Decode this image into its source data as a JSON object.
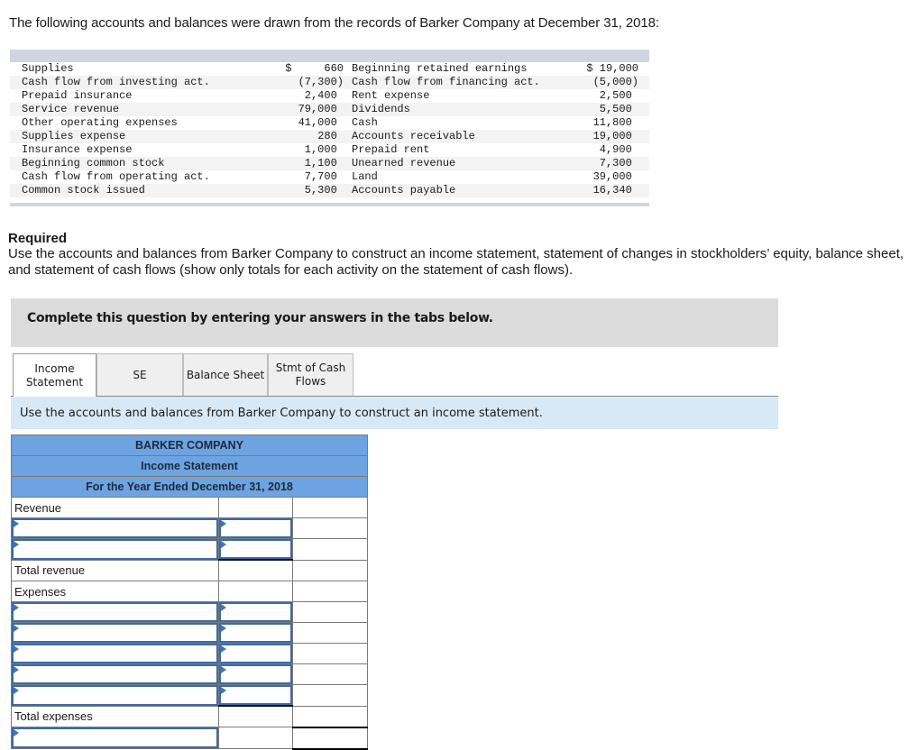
{
  "intro": "The following accounts and balances were drawn from the records of Barker Company at December 31, 2018:",
  "accounts": {
    "rows": [
      {
        "left_name": "Supplies",
        "left_value": "$     660",
        "right_name": "Beginning retained earnings",
        "right_value": "$ 19,000"
      },
      {
        "left_name": "Cash flow from investing act.",
        "left_value": "(7,300)",
        "right_name": "Cash flow from financing act.",
        "right_value": "(5,000)"
      },
      {
        "left_name": "Prepaid insurance",
        "left_value": "2,400 ",
        "right_name": "Rent expense",
        "right_value": "2,500 "
      },
      {
        "left_name": "Service revenue",
        "left_value": "79,000 ",
        "right_name": "Dividends",
        "right_value": "5,500 "
      },
      {
        "left_name": "Other operating expenses",
        "left_value": "41,000 ",
        "right_name": "Cash",
        "right_value": "11,800 "
      },
      {
        "left_name": "Supplies expense",
        "left_value": "280 ",
        "right_name": "Accounts receivable",
        "right_value": "19,000 "
      },
      {
        "left_name": "Insurance expense",
        "left_value": "1,000 ",
        "right_name": "Prepaid rent",
        "right_value": "4,900 "
      },
      {
        "left_name": "Beginning common stock",
        "left_value": "1,100 ",
        "right_name": "Unearned revenue",
        "right_value": "7,300 "
      },
      {
        "left_name": "Cash flow from operating act.",
        "left_value": "7,700 ",
        "right_name": "Land",
        "right_value": "39,000 "
      },
      {
        "left_name": "Common stock issued",
        "left_value": "5,300 ",
        "right_name": "Accounts payable",
        "right_value": "16,340 "
      }
    ]
  },
  "required": {
    "title": "Required",
    "text": "Use the accounts and balances from Barker Company to construct an income statement, statement of changes in stockholders’ equity, balance sheet, and statement of cash flows (show only totals for each activity on the statement of cash flows)."
  },
  "complete_prompt": "Complete this question by entering your answers in the tabs below.",
  "tabs": [
    {
      "label": "Income Statement",
      "line1": "Income",
      "line2": "Statement",
      "active": true
    },
    {
      "label": "SE",
      "line1": "SE",
      "line2": "",
      "active": false
    },
    {
      "label": "Balance Sheet",
      "line1": "Balance Sheet",
      "line2": "",
      "active": false
    },
    {
      "label": "Stmt of Cash Flows",
      "line1": "Stmt of Cash",
      "line2": "Flows",
      "active": false
    }
  ],
  "instruction": "Use the accounts and balances from Barker Company to construct an income statement.",
  "statement": {
    "company": "BARKER COMPANY",
    "title": "Income Statement",
    "period": "For the Year Ended December 31, 2018",
    "revenue_label": "Revenue",
    "total_revenue_label": "Total revenue",
    "expenses_label": "Expenses",
    "total_expenses_label": "Total expenses",
    "revenue_inputs": [
      {
        "name": "",
        "amount": ""
      },
      {
        "name": "",
        "amount": ""
      }
    ],
    "expense_inputs": [
      {
        "name": "",
        "amount": ""
      },
      {
        "name": "",
        "amount": ""
      },
      {
        "name": "",
        "amount": ""
      },
      {
        "name": "",
        "amount": ""
      },
      {
        "name": "",
        "amount": ""
      }
    ],
    "net_income_input": ""
  }
}
